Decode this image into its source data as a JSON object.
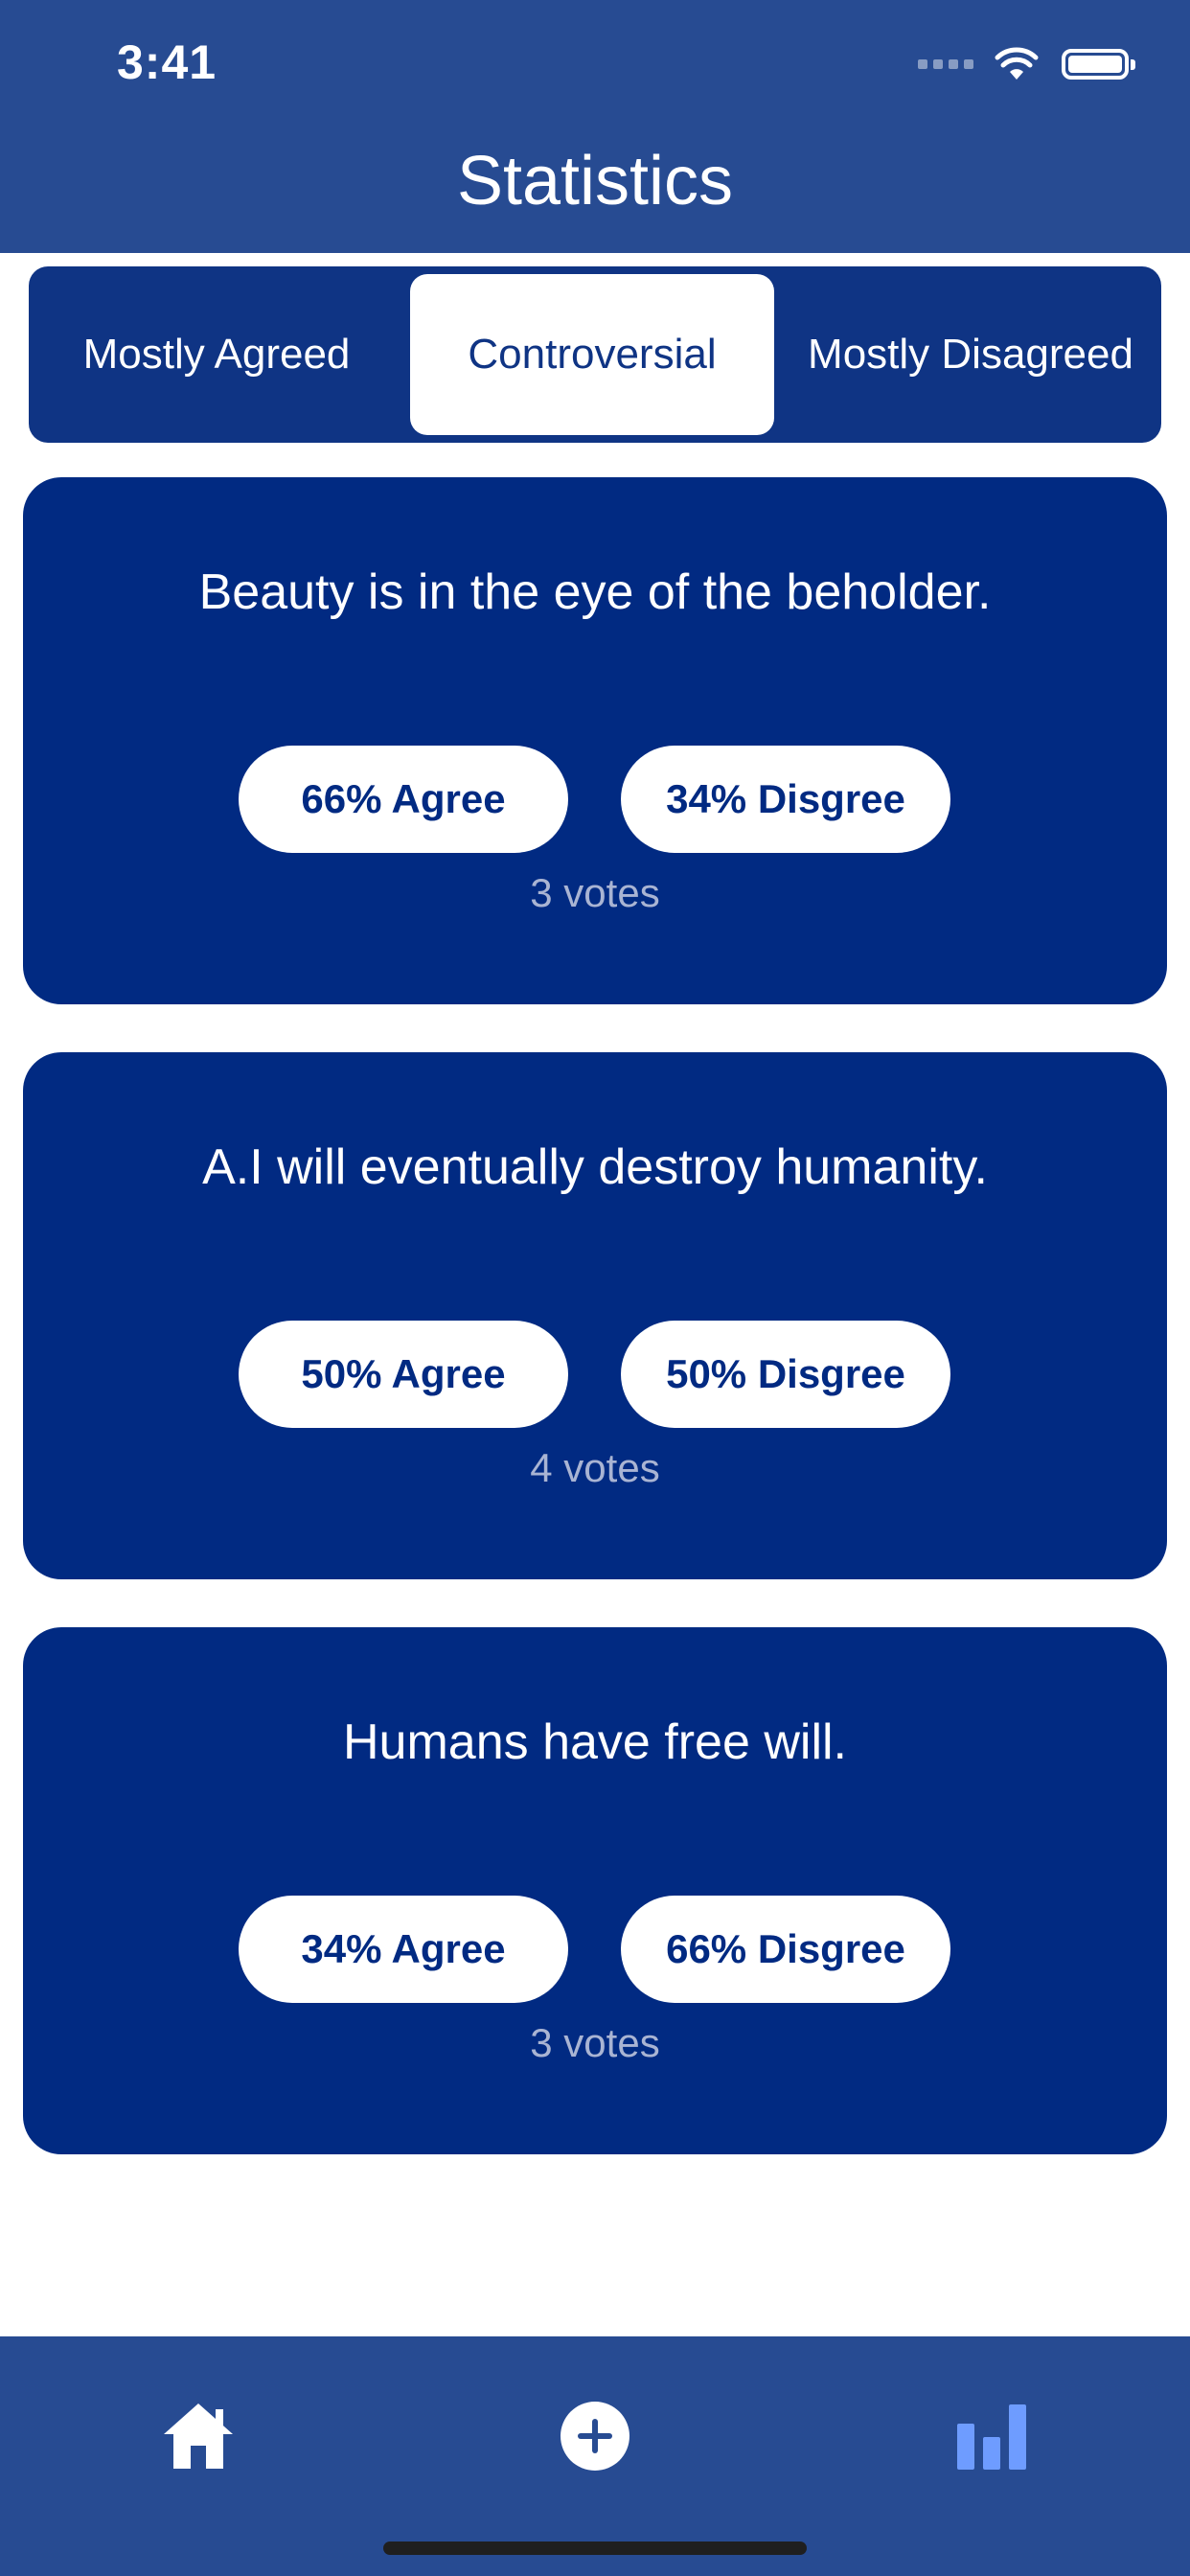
{
  "status_bar": {
    "time": "3:41"
  },
  "header": {
    "title": "Statistics"
  },
  "segments": [
    {
      "label": "Mostly Agreed",
      "selected": false
    },
    {
      "label": "Controversial",
      "selected": true
    },
    {
      "label": "Mostly Disagreed",
      "selected": false
    }
  ],
  "cards": [
    {
      "statement": "Beauty is in the eye of the beholder.",
      "agree_label": "66% Agree",
      "disagree_label": "34% Disgree",
      "votes": "3 votes"
    },
    {
      "statement": "A.I will eventually destroy humanity.",
      "agree_label": "50% Agree",
      "disagree_label": "50% Disgree",
      "votes": "4 votes"
    },
    {
      "statement": "Humans have free will.",
      "agree_label": "34% Agree",
      "disagree_label": "66% Disgree",
      "votes": "3 votes"
    }
  ],
  "tab_bar": {
    "items": [
      {
        "icon": "home-icon",
        "active": false
      },
      {
        "icon": "plus-circle-icon",
        "active": false
      },
      {
        "icon": "bar-chart-icon",
        "active": true
      }
    ]
  },
  "colors": {
    "header_bg": "#274b92",
    "card_bg": "#012a82",
    "segmented_bg": "#0f3484",
    "active_tab": "#6e9cff",
    "votes_text": "#a9b4d3"
  }
}
